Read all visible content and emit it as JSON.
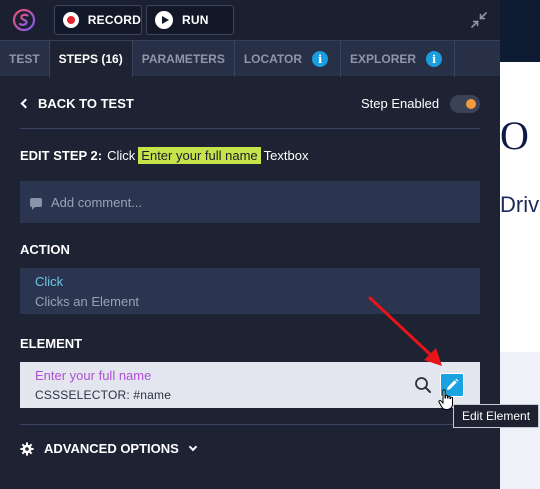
{
  "toolbar": {
    "record_label": "RECORD",
    "run_label": "RUN"
  },
  "tabs": [
    {
      "label": "TEST",
      "active": false
    },
    {
      "label": "STEPS (16)",
      "active": true
    },
    {
      "label": "PARAMETERS",
      "active": false
    },
    {
      "label": "LOCATOR",
      "active": false,
      "info": true
    },
    {
      "label": "EXPLORER",
      "active": false,
      "info": true
    }
  ],
  "info_glyph": "i",
  "nav": {
    "back_label": "BACK TO TEST",
    "step_enabled_label": "Step Enabled",
    "step_enabled": true
  },
  "edit_step": {
    "label": "EDIT STEP 2:",
    "action_word": "Click",
    "highlight": "Enter your full name",
    "element_type": "Textbox"
  },
  "comment": {
    "placeholder": "Add comment..."
  },
  "action": {
    "section_label": "ACTION",
    "name": "Click",
    "description": "Clicks an Element"
  },
  "element": {
    "section_label": "ELEMENT",
    "name": "Enter your full name",
    "selector": "CSSSELECTOR: #name"
  },
  "tooltip": {
    "text": "Edit Element"
  },
  "advanced": {
    "label": "ADVANCED OPTIONS"
  },
  "background_page": {
    "heading_fragment": "O",
    "subtitle_fragment": "Driv"
  },
  "colors": {
    "panel_bg": "#1d2333",
    "accent_blue": "#1aa3e0",
    "highlight_green": "#c6e34a",
    "toggle_orange": "#f39a3d",
    "record_red": "#e2262f",
    "element_purple": "#b14fd6",
    "action_cyan": "#6cc7e8",
    "annotation_red": "#e8141a"
  }
}
